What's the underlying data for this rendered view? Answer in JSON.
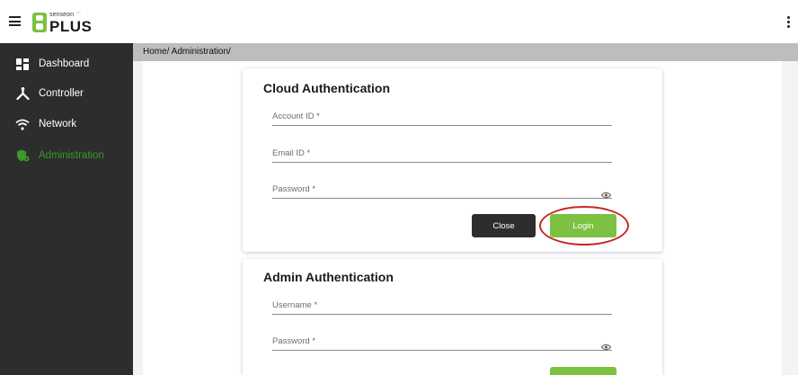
{
  "header": {
    "logo_small": "senseon",
    "logo_big": "PLUS"
  },
  "sidebar": {
    "items": [
      {
        "label": "Dashboard",
        "icon": "dashboard-icon"
      },
      {
        "label": "Controller",
        "icon": "controller-icon"
      },
      {
        "label": "Network",
        "icon": "wifi-icon"
      },
      {
        "label": "Administration",
        "icon": "admin-shield-icon",
        "active": true
      }
    ]
  },
  "breadcrumb": "Home/ Administration/",
  "cloud_auth": {
    "title": "Cloud Authentication",
    "account_id_placeholder": "Account ID *",
    "email_id_placeholder": "Email ID *",
    "password_placeholder": "Password *",
    "close_label": "Close",
    "login_label": "Login"
  },
  "admin_auth": {
    "title": "Admin Authentication",
    "username_placeholder": "Username *",
    "password_placeholder": "Password *"
  },
  "colors": {
    "accent_green": "#7cc142",
    "active_nav_green": "#3a9a2b",
    "sidebar_bg": "#2d2d2d",
    "breadcrumb_bg": "#bdbdbd",
    "highlight_red": "#c62828"
  }
}
